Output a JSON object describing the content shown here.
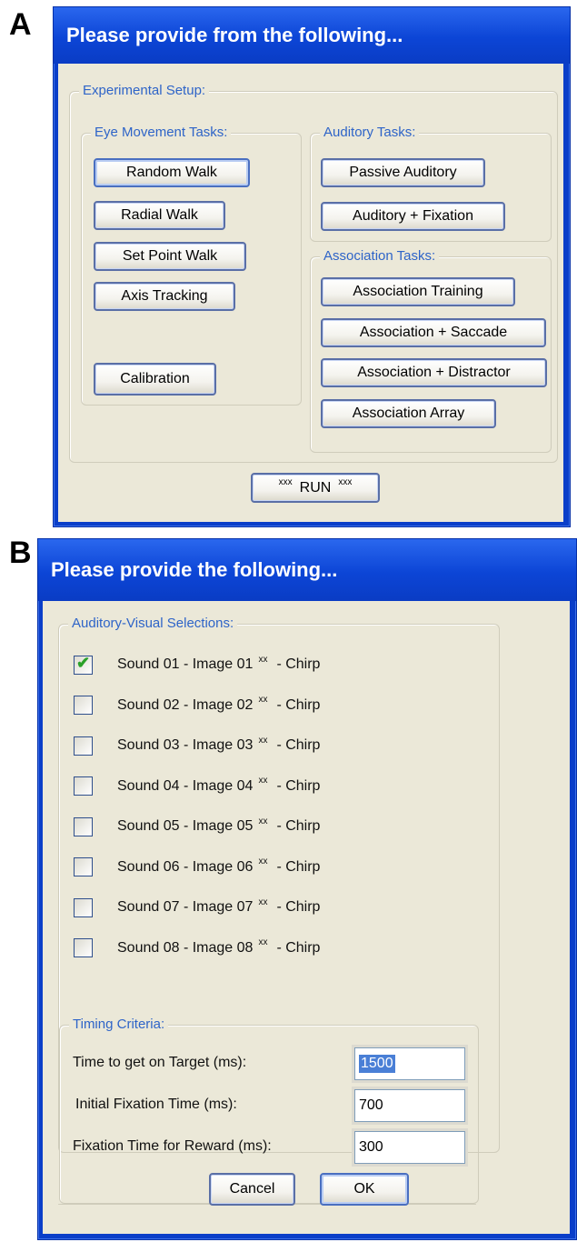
{
  "panel_a": {
    "letter": "A",
    "title": "Please provide from the following...",
    "experimental_setup_label": "Experimental Setup:",
    "eye_movement_label": "Eye Movement Tasks:",
    "eye_buttons": {
      "random_walk": "Random Walk",
      "radial_walk": "Radial Walk",
      "set_point_walk": "Set Point Walk",
      "axis_tracking": "Axis Tracking",
      "calibration": "Calibration"
    },
    "auditory_label": "Auditory Tasks:",
    "auditory_buttons": {
      "passive_auditory": "Passive Auditory",
      "auditory_fixation": "Auditory + Fixation"
    },
    "association_label": "Association Tasks:",
    "association_buttons": {
      "training": "Association Training",
      "saccade": "Association + Saccade",
      "distractor": "Association + Distractor",
      "array": "Association Array"
    },
    "run_button": {
      "prefix": "xxx",
      "label": "RUN",
      "suffix": "xxx"
    }
  },
  "panel_b": {
    "letter": "B",
    "title": "Please provide the following...",
    "av_label": "Auditory-Visual Selections:",
    "selections": [
      {
        "text": "Sound 01 - Image 01",
        "mark": "xx",
        "suffix": "- Chirp",
        "checked": true
      },
      {
        "text": "Sound 02 - Image 02",
        "mark": "xx",
        "suffix": "- Chirp",
        "checked": false
      },
      {
        "text": "Sound 03 - Image 03",
        "mark": "xx",
        "suffix": "- Chirp",
        "checked": false
      },
      {
        "text": "Sound 04 - Image 04",
        "mark": "xx",
        "suffix": "- Chirp",
        "checked": false
      },
      {
        "text": "Sound 05 - Image 05",
        "mark": "xx",
        "suffix": "- Chirp",
        "checked": false
      },
      {
        "text": "Sound 06 - Image 06",
        "mark": "xx",
        "suffix": "- Chirp",
        "checked": false
      },
      {
        "text": "Sound 07 - Image 07",
        "mark": "xx",
        "suffix": "- Chirp",
        "checked": false
      },
      {
        "text": "Sound 08 - Image 08",
        "mark": "xx",
        "suffix": "- Chirp",
        "checked": false
      }
    ],
    "check_glyph": "✔",
    "timing_label": "Timing Criteria:",
    "timing": {
      "target_label": "Time to get on Target (ms):",
      "target_value": "1500",
      "initial_label": "Initial Fixation Time (ms):",
      "initial_value": "700",
      "reward_label": "Fixation Time for Reward (ms):",
      "reward_value": "300"
    },
    "cancel_label": "Cancel",
    "ok_label": "OK"
  },
  "colors": {
    "titlebar": "#0c45d6",
    "dialog_bg": "#ebe8d8",
    "group_label": "#2e64c8",
    "selection": "#4a7fd6",
    "check": "#2aa12a"
  }
}
